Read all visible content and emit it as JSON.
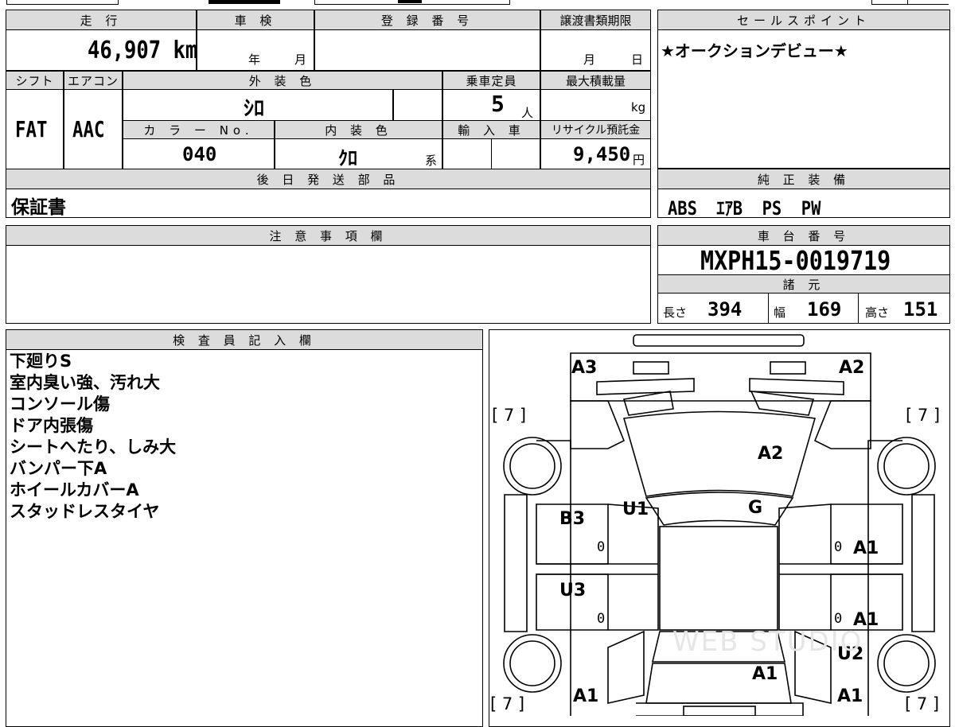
{
  "top": {
    "mileage_header": "走 行",
    "mileage_value": "46,907 km",
    "shaken_header": "車 検",
    "shaken_year": "年",
    "shaken_month": "月",
    "reg_header": "登 録 番 号",
    "transfer_header": "譲渡書類期限",
    "transfer_month": "月",
    "transfer_day": "日",
    "shift_header": "シフト",
    "shift_value": "FAT",
    "ac_header": "エアコン",
    "ac_value": "AAC",
    "exterior_header": "外 装 色",
    "exterior_value": "ｼﾛ",
    "capacity_header": "乗車定員",
    "capacity_value": "5",
    "capacity_unit": "人",
    "maxload_header": "最大積載量",
    "maxload_unit": "kg",
    "colorno_header": "カ ラ ー No.",
    "colorno_value": "040",
    "interior_header": "内 装 色",
    "interior_value": "ｸﾛ",
    "interior_suffix": "系",
    "import_header": "輸 入 車",
    "recycle_header": "リサイクル預託金",
    "recycle_value": "9,450",
    "recycle_unit": "円",
    "later_parts_header": "後 日 発 送 部 品",
    "later_parts_value": "保証書"
  },
  "sales": {
    "header": "セールスポイント",
    "text": "★オークションデビュー★"
  },
  "equipment": {
    "header": "純 正 装 備",
    "value": "ABS  ｴｱB  PS  PW"
  },
  "notes": {
    "header": "注 意 事 項 欄"
  },
  "chassis": {
    "header": "車 台 番 号",
    "value": "MXPH15-0019719"
  },
  "specs": {
    "header": "諸 元",
    "length_label": "長さ",
    "length_value": "394",
    "width_label": "幅",
    "width_value": "169",
    "height_label": "高さ",
    "height_value": "151"
  },
  "inspector": {
    "header": "検 査 員 記 入 欄",
    "lines": [
      "下廻りS",
      "室内臭い強、汚れ大",
      "コンソール傷",
      "ドア内張傷",
      "シートへたり、しみ大",
      "バンパー下A",
      "ホイールカバーA",
      "スタッドレスタイヤ"
    ]
  },
  "diagram": {
    "labels": {
      "front_left": "A3",
      "front_right": "A2",
      "hood": "A2",
      "windshield_g": "G",
      "roof_u1": "U1",
      "door_fl": "B3",
      "door_rl": "U3",
      "door_fr": "A1",
      "door_rr": "A1",
      "wheel_rr": "U2",
      "rear_center": "A1",
      "rear_left": "A1",
      "rear_right": "A1",
      "zero_1": "0",
      "zero_2": "0",
      "zero_3": "0",
      "zero_4": "0"
    },
    "tire_marks": {
      "tl": "[ 7 ]",
      "tr": "[ 7 ]",
      "bl": "[ 7 ]",
      "br": "[ 7 ]"
    },
    "watermark": "WEB STUDIO"
  }
}
